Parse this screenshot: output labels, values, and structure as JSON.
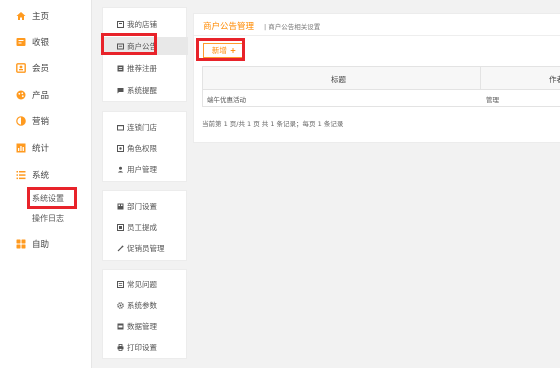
{
  "nav": {
    "items": [
      {
        "icon": "home-icon",
        "label": "主页"
      },
      {
        "icon": "cashier-icon",
        "label": "收银"
      },
      {
        "icon": "member-icon",
        "label": "会员"
      },
      {
        "icon": "product-icon",
        "label": "产品"
      },
      {
        "icon": "marketing-icon",
        "label": "营销"
      },
      {
        "icon": "stats-icon",
        "label": "统计"
      },
      {
        "icon": "system-icon",
        "label": "系统"
      },
      {
        "icon": "help-icon",
        "label": "自助"
      }
    ],
    "system_sub": [
      "系统设置",
      "操作日志"
    ]
  },
  "submenu": {
    "groups": [
      [
        "我的店铺",
        "商户公告",
        "推荐注册",
        "系统提醒"
      ],
      [
        "连锁门店",
        "角色权限",
        "用户管理"
      ],
      [
        "部门设置",
        "员工提成",
        "促销员管理"
      ],
      [
        "常见问题",
        "系统参数",
        "数据管理",
        "打印设置"
      ]
    ]
  },
  "panel": {
    "title": "商户公告管理",
    "description": "| 商户公告相关设置",
    "new_button": "新增",
    "columns": [
      "标题",
      "作者"
    ],
    "rows": [
      {
        "title": "端午优惠活动",
        "author": "管理"
      }
    ],
    "pager": "当前第 1 页/共 1 页  共 1 条记录；每页 1 条记录"
  },
  "colors": {
    "accent": "#ff8a00",
    "highlight": "#e8232a"
  }
}
